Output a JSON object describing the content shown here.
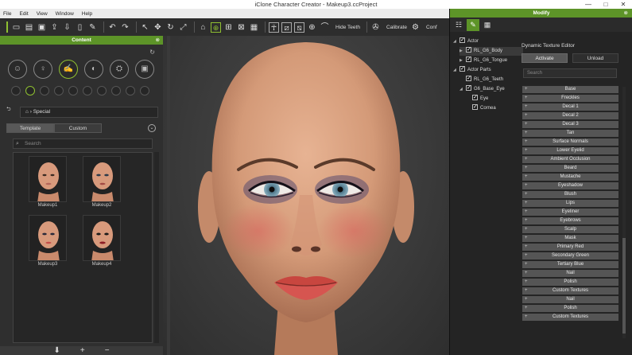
{
  "title": "iClone Character Creator - Makeup3.ccProject",
  "window_controls": [
    "—",
    "□",
    "✕"
  ],
  "menu": [
    "File",
    "Edit",
    "View",
    "Window",
    "Help"
  ],
  "toolbar": {
    "hide_teeth": "Hide Teeth",
    "calibrate": "Calibrate",
    "conf": "Conf"
  },
  "content_panel": {
    "header": "Content",
    "close": "⊗",
    "path": "Special",
    "tabs": [
      "Template",
      "Custom"
    ],
    "search_placeholder": "Search",
    "items": [
      "Makeup1",
      "Makeup2",
      "Makeup3",
      "Makeup4"
    ]
  },
  "modify_panel": {
    "header": "Modify",
    "close": "⊗",
    "tree": [
      "Actor",
      "RL_G6_Body",
      "RL_G6_Tongue",
      "Actor Parts",
      "RL_G6_Teeth",
      "G6_Base_Eye",
      "Eye",
      "Cornea"
    ],
    "dte_title": "Dynamic Texture Editor",
    "activate": "Activate",
    "unload": "Unload",
    "search_placeholder": "Search",
    "layers": [
      "Base",
      "Freckles",
      "Decal 1",
      "Decal 2",
      "Decal 3",
      "Tan",
      "Surface Normals",
      "Lower Eyelid",
      "Ambient Occlusion",
      "Beard",
      "Mustache",
      "Eyeshadow",
      "Blush",
      "Lips",
      "Eyeliner",
      "Eyebrows",
      "Scalp",
      "Mask",
      "Primary Red",
      "Secondary Green",
      "Tertiary Blue",
      "Nail",
      "Polish",
      "Custom Textures",
      "Nail",
      "Polish",
      "Custom Textures"
    ]
  },
  "colors": {
    "accent": "#5d9428",
    "green_icon": "#8fc031"
  }
}
